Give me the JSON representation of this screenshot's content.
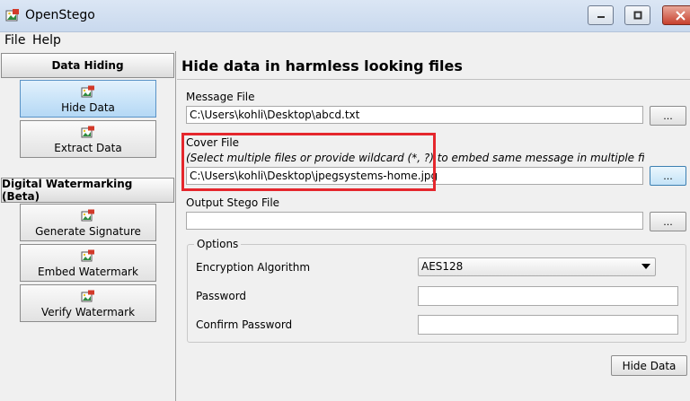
{
  "window": {
    "title": "OpenStego",
    "icon": "stego-app-icon",
    "controls": {
      "minimize": "▭",
      "maximize": "▢",
      "close": "✕"
    }
  },
  "menu": {
    "items": [
      "File",
      "Help"
    ]
  },
  "sidebar": {
    "sections": [
      {
        "title": "Data Hiding",
        "buttons": [
          {
            "label": "Hide Data",
            "active": true
          },
          {
            "label": "Extract Data",
            "active": false
          }
        ]
      },
      {
        "title": "Digital Watermarking (Beta)",
        "buttons": [
          {
            "label": "Generate Signature"
          },
          {
            "label": "Embed Watermark"
          },
          {
            "label": "Verify Watermark"
          }
        ]
      }
    ]
  },
  "main": {
    "heading": "Hide data in harmless looking files",
    "message_file": {
      "label": "Message File",
      "value": "C:\\Users\\kohli\\Desktop\\abcd.txt",
      "browse": "..."
    },
    "cover_file": {
      "label": "Cover File",
      "hint": "(Select multiple files or provide wildcard (*, ?) to embed same message in multiple files)",
      "value": "C:\\Users\\kohli\\Desktop\\jpegsystems-home.jpg",
      "browse": "...",
      "highlight_color": "#e5272d"
    },
    "output_file": {
      "label": "Output Stego File",
      "value": "",
      "browse": "..."
    },
    "options": {
      "title": "Options",
      "encryption": {
        "label": "Encryption Algorithm",
        "selected": "AES128"
      },
      "password": {
        "label": "Password",
        "value": ""
      },
      "confirm_password": {
        "label": "Confirm Password",
        "value": ""
      }
    },
    "action_button": "Hide Data"
  },
  "colors": {
    "accent": "#5a93c6",
    "highlight": "#e5272d"
  }
}
